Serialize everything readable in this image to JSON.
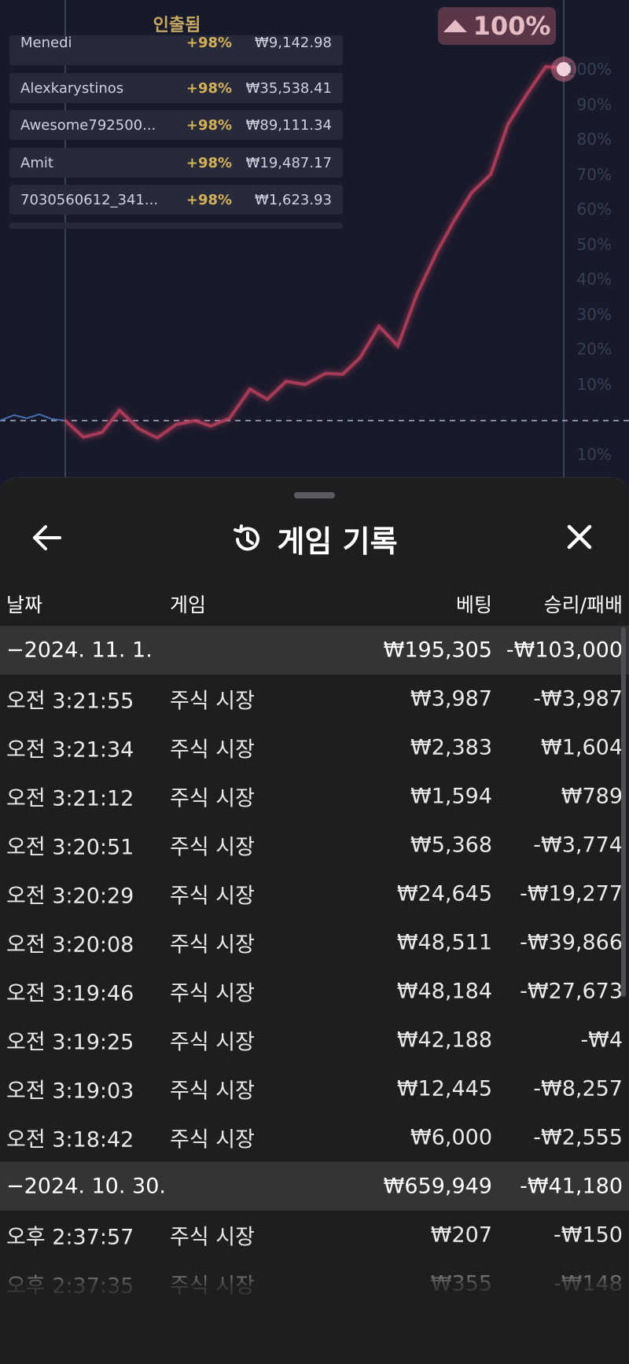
{
  "game_area": {
    "cashout_title": "인출됨",
    "multiplier_badge": "100%",
    "cashouts": [
      {
        "name": "Menedi",
        "mult": "+98%",
        "amount": "₩9,142.98"
      },
      {
        "name": "Alexkarystinos",
        "mult": "+98%",
        "amount": "₩35,538.41"
      },
      {
        "name": "Awesome792500...",
        "mult": "+98%",
        "amount": "₩89,111.34"
      },
      {
        "name": "Amit",
        "mult": "+98%",
        "amount": "₩19,487.17"
      },
      {
        "name": "7030560612_341...",
        "mult": "+98%",
        "amount": "₩1,623.93"
      }
    ],
    "axis_ticks": [
      "100%",
      "90%",
      "80%",
      "70%",
      "60%",
      "50%",
      "40%",
      "30%",
      "20%",
      "10%",
      "10%"
    ],
    "colors": {
      "line": "#c0405e",
      "multiplier": "#d4b057",
      "cashout_title": "#c8a865"
    }
  },
  "sheet": {
    "title": "게임 기록",
    "columns": {
      "date": "날짜",
      "game": "게임",
      "bet": "베팅",
      "result": "승리/패배"
    },
    "groups": [
      {
        "date": "−2024. 11. 1.",
        "bet_total": "₩195,305",
        "result_total": "-₩103,000",
        "rows": [
          {
            "time": "오전 3:21:55",
            "game": "주식 시장",
            "bet": "₩3,987",
            "result": "-₩3,987"
          },
          {
            "time": "오전 3:21:34",
            "game": "주식 시장",
            "bet": "₩2,383",
            "result": "₩1,604"
          },
          {
            "time": "오전 3:21:12",
            "game": "주식 시장",
            "bet": "₩1,594",
            "result": "₩789"
          },
          {
            "time": "오전 3:20:51",
            "game": "주식 시장",
            "bet": "₩5,368",
            "result": "-₩3,774"
          },
          {
            "time": "오전 3:20:29",
            "game": "주식 시장",
            "bet": "₩24,645",
            "result": "-₩19,277"
          },
          {
            "time": "오전 3:20:08",
            "game": "주식 시장",
            "bet": "₩48,511",
            "result": "-₩39,866"
          },
          {
            "time": "오전 3:19:46",
            "game": "주식 시장",
            "bet": "₩48,184",
            "result": "-₩27,673"
          },
          {
            "time": "오전 3:19:25",
            "game": "주식 시장",
            "bet": "₩42,188",
            "result": "-₩4"
          },
          {
            "time": "오전 3:19:03",
            "game": "주식 시장",
            "bet": "₩12,445",
            "result": "-₩8,257"
          },
          {
            "time": "오전 3:18:42",
            "game": "주식 시장",
            "bet": "₩6,000",
            "result": "-₩2,555"
          }
        ]
      },
      {
        "date": "−2024. 10. 30.",
        "bet_total": "₩659,949",
        "result_total": "-₩41,180",
        "rows": [
          {
            "time": "오후 2:37:57",
            "game": "주식 시장",
            "bet": "₩207",
            "result": "-₩150"
          },
          {
            "time": "오후 2:37:35",
            "game": "주식 시장",
            "bet": "₩355",
            "result": "-₩148"
          }
        ]
      }
    ],
    "icons": {
      "back": "arrow-left-icon",
      "history": "history-clock-icon",
      "close": "close-icon"
    }
  }
}
